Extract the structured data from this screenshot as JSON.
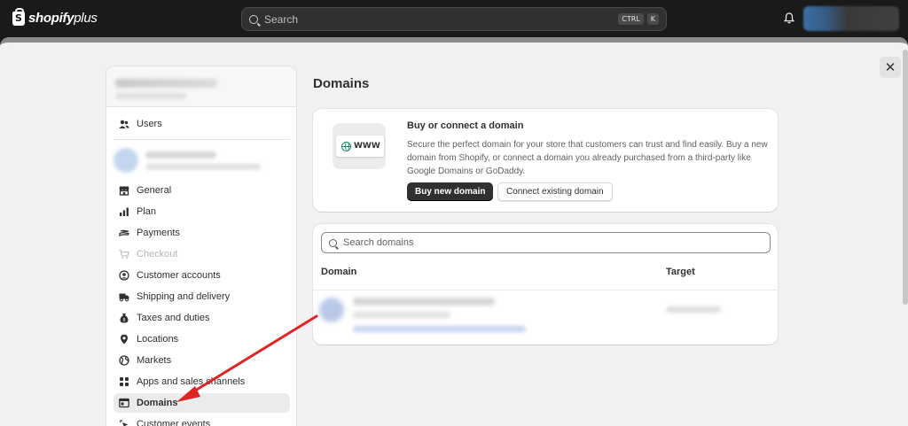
{
  "topbar": {
    "brand_name": "shopify",
    "brand_suffix": "plus",
    "search_placeholder": "Search",
    "shortcut_ctrl": "CTRL",
    "shortcut_key": "K"
  },
  "modal": {
    "close_symbol": "✕"
  },
  "sidebar": {
    "items": [
      {
        "label": "Users",
        "icon": "users-icon"
      },
      {
        "label": "General",
        "icon": "store-icon"
      },
      {
        "label": "Plan",
        "icon": "plan-icon"
      },
      {
        "label": "Payments",
        "icon": "payments-icon"
      },
      {
        "label": "Checkout",
        "icon": "cart-icon"
      },
      {
        "label": "Customer accounts",
        "icon": "customer-accounts-icon"
      },
      {
        "label": "Shipping and delivery",
        "icon": "truck-icon"
      },
      {
        "label": "Taxes and duties",
        "icon": "taxes-icon"
      },
      {
        "label": "Locations",
        "icon": "location-pin-icon"
      },
      {
        "label": "Markets",
        "icon": "globe-icon"
      },
      {
        "label": "Apps and sales channels",
        "icon": "apps-icon"
      },
      {
        "label": "Domains",
        "icon": "domains-icon"
      },
      {
        "label": "Customer events",
        "icon": "customer-events-icon"
      }
    ]
  },
  "main": {
    "title": "Domains",
    "buy_card": {
      "illustration_label": "WWW",
      "title": "Buy or connect a domain",
      "description": "Secure the perfect domain for your store that customers can trust and find easily. Buy a new domain from Shopify, or connect a domain you already purchased from a third-party like Google Domains or GoDaddy.",
      "primary_button": "Buy new domain",
      "secondary_button": "Connect existing domain"
    },
    "domains_card": {
      "search_placeholder": "Search domains",
      "col_domain": "Domain",
      "col_target": "Target"
    }
  },
  "colors": {
    "topbar_bg": "#1a1a1a",
    "modal_bg": "#f1f1f1",
    "primary_button_bg": "#303030",
    "arrow": "#e02424",
    "globe": "#1f8a66"
  }
}
